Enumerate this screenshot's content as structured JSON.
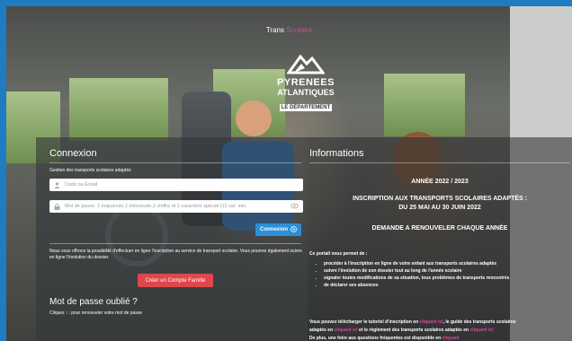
{
  "header": {
    "title_part1": "Trans",
    "title_part2": "Scolaire",
    "accent_color": "#d24a9f"
  },
  "logo": {
    "line1": "PYRENEES",
    "line2": "ATLANTIQUES",
    "line3": "LE DÉPARTEMENT"
  },
  "login": {
    "title": "Connexion",
    "subtitle": "Gestion des transports scolaires adaptés",
    "email_placeholder": "Code ou Email",
    "password_placeholder": "Mot de passe. 1 majuscule,1 minuscule,1 chiffre et 1 caractère spécial (12 car. min",
    "submit_label": "Connexion",
    "submit_icon": "arrow-circle-icon",
    "intro_text": "Nous vous offrons la possibilité d'effectuer en ligne l'inscription au service de transport scolaire. Vous pourrez également suivre en ligne l'évolution du dossier.",
    "create_label": "Créer un Compte Famille",
    "forgot_title": "Mot de passe oublié ?",
    "forgot_prefix": "Cliquez",
    "forgot_link": "ici",
    "forgot_suffix": "pour renouveler votre mot de passe"
  },
  "info": {
    "title": "Informations",
    "year": "ANNÉE 2022 / 2023",
    "headline1": "INSCRIPTION AUX TRANSPORTS SCOLAIRES ADAPTÉS :",
    "headline2": "DU 25 MAI AU 30 JUIN 2022",
    "headline3": "DEMANDE A RENOUVELER CHAQUE ANNÉE",
    "intro": "Ce portail vous permet de :",
    "items": [
      "procéder à l'inscription en ligne de votre enfant aux transports scolaires adaptés",
      "suivre l'évolution de son dossier tout au long de l'année scolaire",
      "signaler toutes modifications de sa situation, tous problèmes de transports rencontrés",
      "de déclarer ses absences"
    ],
    "download_text1": "Vous pouvez télécharger le tutoriel d'inscription en",
    "download_link": "cliquant ici",
    "download_text2": ", le guide des transports scolaires",
    "download_text3": "adaptés en",
    "download_link2": "cliquant ici",
    "download_text4": "et le règlement des transports scolaires adaptés en",
    "download_link3": "cliquant ici",
    "faq_text": "De plus, une foire aux questions fréquentes est disponible en",
    "faq_link": "cliquant"
  },
  "colors": {
    "frame_border": "#1f7bc2",
    "button_blue": "#2c8fd6",
    "button_red": "#e0474c"
  }
}
